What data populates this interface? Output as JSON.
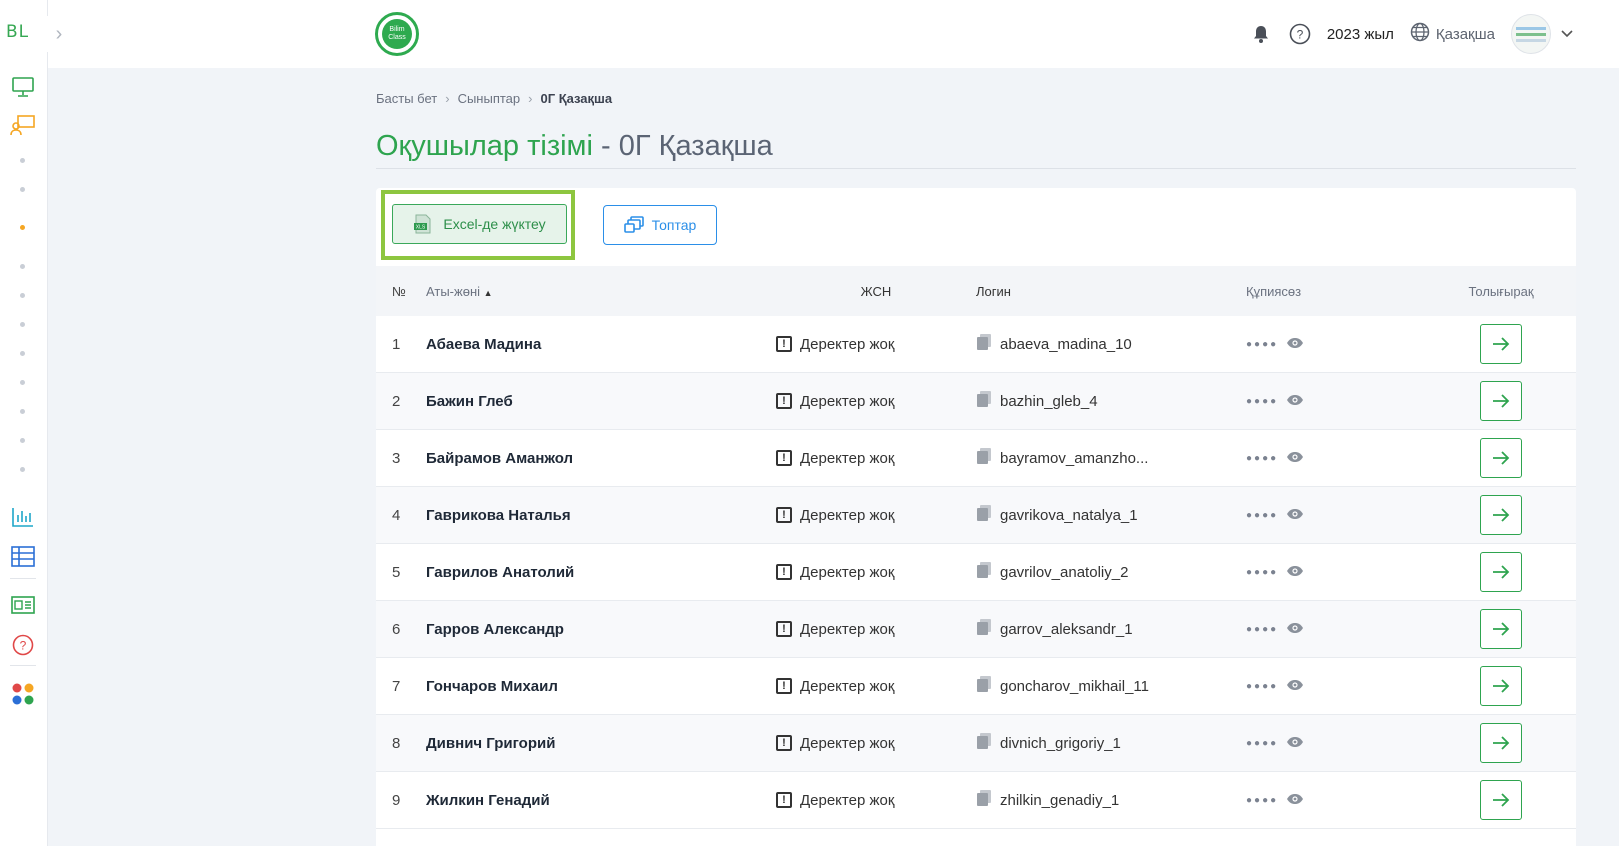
{
  "sidebar": {
    "brand": "BL",
    "collapse_icon": "chevron-right-icon",
    "icons": [
      "monitor-icon",
      "classroom-icon",
      "chart-icon",
      "table-icon",
      "id-card-icon",
      "help-icon",
      "apps-icon"
    ],
    "active_color": "#f5a623"
  },
  "header": {
    "logo_text_1": "Bilim",
    "logo_text_2": "Class",
    "year": "2023 жыл",
    "language": "Қазақша"
  },
  "breadcrumb": [
    "Басты бет",
    "Сыныптар",
    "0Г Қазақша"
  ],
  "page": {
    "title_main": "Оқушылар тізімі",
    "title_sep": " - ",
    "title_class": "0Г Қазақша"
  },
  "toolbar": {
    "excel_label": "Excel-де жүктеу",
    "excel_badge": "XLS",
    "groups_label": "Топтар"
  },
  "table": {
    "headers": {
      "no": "№",
      "name": "Аты-жөні",
      "jsn": "ЖСН",
      "login": "Логин",
      "password": "Құпиясөз",
      "more": "Толығырақ"
    },
    "rows": [
      {
        "no": "1",
        "name": "Абаева Мадина",
        "jsn": "Деректер жоқ",
        "login": "abaeva_madina_10"
      },
      {
        "no": "2",
        "name": "Бажин Глеб",
        "jsn": "Деректер жоқ",
        "login": "bazhin_gleb_4"
      },
      {
        "no": "3",
        "name": "Байрамов Аманжол",
        "jsn": "Деректер жоқ",
        "login": "bayramov_amanzho..."
      },
      {
        "no": "4",
        "name": "Гаврикова Наталья",
        "jsn": "Деректер жоқ",
        "login": "gavrikova_natalya_1"
      },
      {
        "no": "5",
        "name": "Гаврилов Анатолий",
        "jsn": "Деректер жоқ",
        "login": "gavrilov_anatoliy_2"
      },
      {
        "no": "6",
        "name": "Гарров Александр",
        "jsn": "Деректер жоқ",
        "login": "garrov_aleksandr_1"
      },
      {
        "no": "7",
        "name": "Гончаров Михаил",
        "jsn": "Деректер жоқ",
        "login": "goncharov_mikhail_11"
      },
      {
        "no": "8",
        "name": "Дивнич Григорий",
        "jsn": "Деректер жоқ",
        "login": "divnich_grigoriy_1"
      },
      {
        "no": "9",
        "name": "Жилкин Генадий",
        "jsn": "Деректер жоқ",
        "login": "zhilkin_genadiy_1"
      }
    ],
    "password_mask": "●●●●"
  },
  "colors": {
    "green": "#2ea44f",
    "blue": "#2b8fe8",
    "highlight": "#8dc63f"
  }
}
